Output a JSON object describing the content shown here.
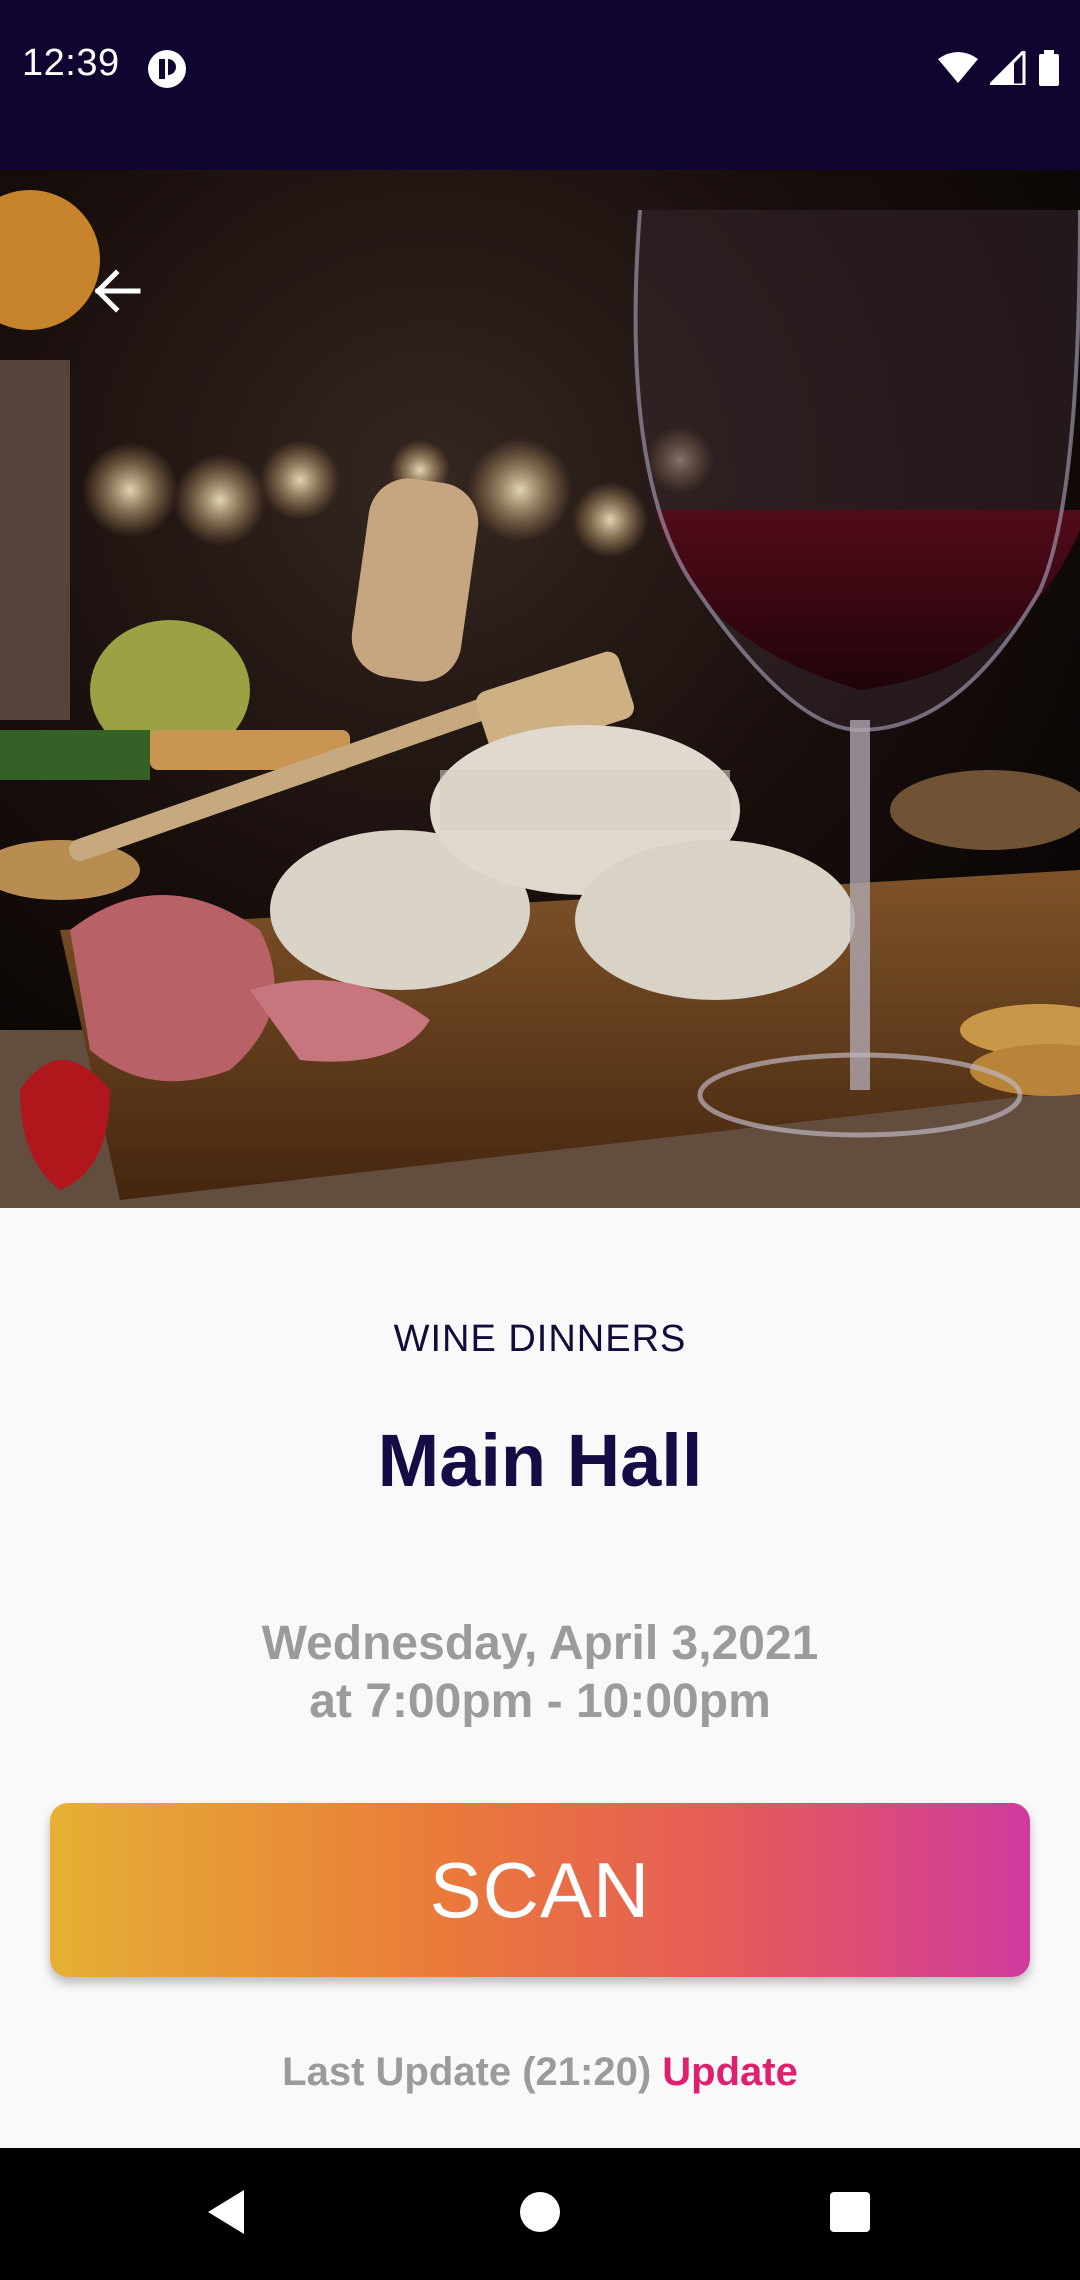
{
  "status_bar": {
    "time": "12:39",
    "icons": [
      "app-notification-icon",
      "wifi-icon",
      "signal-icon",
      "battery-icon"
    ]
  },
  "hero": {
    "image": "wine-and-cheese-board-photo",
    "back_icon": "arrow-left-icon"
  },
  "event": {
    "category": "WINE DINNERS",
    "title": "Main Hall",
    "date_line1": "Wednesday, April 3,2021",
    "date_line2": "at 7:00pm - 10:00pm"
  },
  "actions": {
    "scan_label": "SCAN",
    "last_update_text": "Last Update (21:20)",
    "update_label": "Update"
  },
  "colors": {
    "status_bar_bg": "#0f0530",
    "title": "#160b45",
    "muted_text": "#9b9b9b",
    "update_link": "#e0206f",
    "scan_gradient": [
      "#e5b034",
      "#ea7a3a",
      "#e55a5a",
      "#cf3b9e"
    ]
  },
  "nav_bar": {
    "icons": [
      "back-triangle-icon",
      "home-circle-icon",
      "recents-square-icon"
    ]
  }
}
